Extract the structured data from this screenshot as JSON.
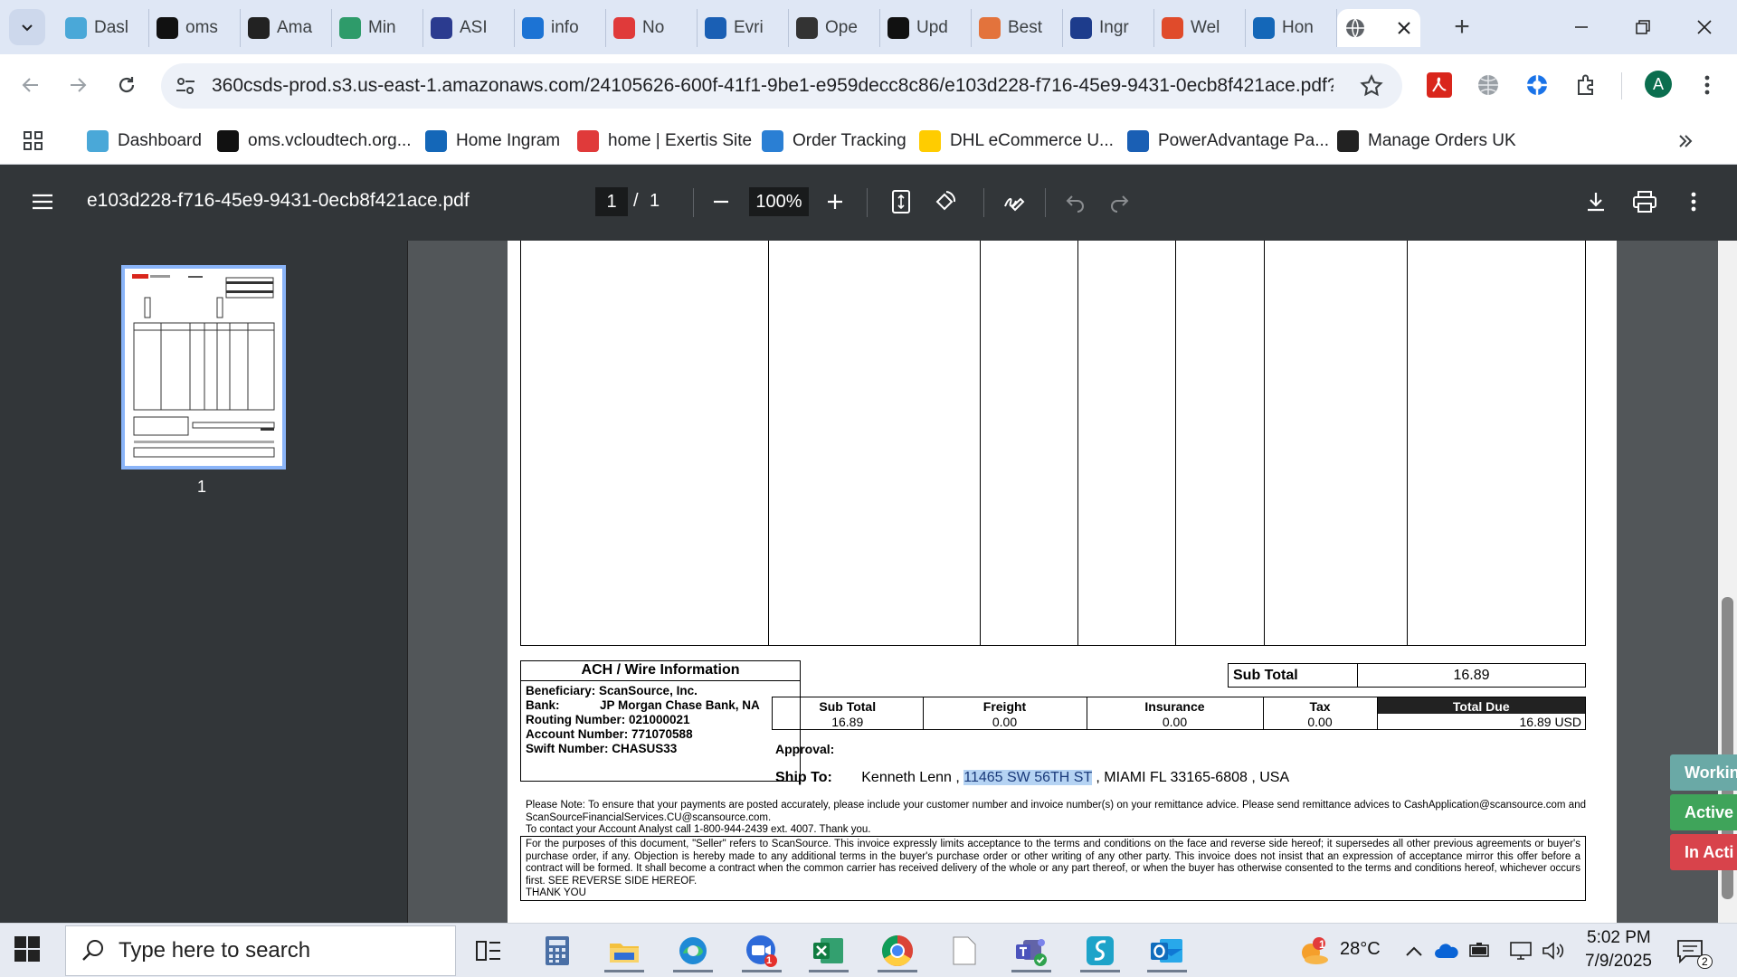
{
  "browser": {
    "tabs": [
      {
        "label": "Dasl",
        "icon": "hexagon-icon",
        "color": "#4aa8d8"
      },
      {
        "label": "oms",
        "icon": "triangle-logo-icon",
        "color": "#111111"
      },
      {
        "label": "Ama",
        "icon": "amazon-icon",
        "color": "#222222"
      },
      {
        "label": "Min",
        "icon": "leaf-icon",
        "color": "#2e9b6a"
      },
      {
        "label": "ASI",
        "icon": "arrow-logo-icon",
        "color": "#2b3b8f"
      },
      {
        "label": "info",
        "icon": "link-logo-icon",
        "color": "#1c73d4"
      },
      {
        "label": "No",
        "icon": "exertis-icon",
        "color": "#e03a3a"
      },
      {
        "label": "Evri",
        "icon": "evri-icon",
        "color": "#1a5fb4"
      },
      {
        "label": "Ope",
        "icon": "openai-icon",
        "color": "#333333"
      },
      {
        "label": "Upd",
        "icon": "openai-icon",
        "color": "#111111"
      },
      {
        "label": "Best",
        "icon": "bulb-icon",
        "color": "#e3733c"
      },
      {
        "label": "Ingr",
        "icon": "ingram-icon",
        "color": "#1d3c8c"
      },
      {
        "label": "Wel",
        "icon": "stack-icon",
        "color": "#e04b2b"
      },
      {
        "label": "Hon",
        "icon": "etn-icon",
        "color": "#1467b8"
      }
    ],
    "active_tab": {
      "icon": "globe-icon"
    },
    "url": "360csds-prod.s3.us-east-1.amazonaws.com/24105626-600f-41f1-9be1-e959decc8c86/e103d228-f716-45e9-9431-0ecb8f421ace.pdf?...",
    "profile_initial": "A",
    "bookmarks": [
      {
        "label": "Dashboard",
        "icon": "hexagon-icon",
        "color": "#4aa8d8"
      },
      {
        "label": "oms.vcloudtech.org...",
        "icon": "triangle-logo-icon",
        "color": "#111111"
      },
      {
        "label": "Home Ingram",
        "icon": "ingram-icon",
        "color": "#1467b8"
      },
      {
        "label": "home | Exertis Site",
        "icon": "exertis-icon",
        "color": "#e03a3a"
      },
      {
        "label": "Order Tracking",
        "icon": "order-tracking-icon",
        "color": "#2a7fd4"
      },
      {
        "label": "DHL eCommerce U...",
        "icon": "dhl-icon",
        "color": "#ffcc00"
      },
      {
        "label": "PowerAdvantage Pa...",
        "icon": "document-icon",
        "color": "#1a5fb4"
      },
      {
        "label": "Manage Orders UK",
        "icon": "amazon-icon",
        "color": "#222222"
      }
    ]
  },
  "pdf": {
    "filename": "e103d228-f716-45e9-9431-0ecb8f421ace.pdf",
    "current_page": "1",
    "page_sep": "/",
    "total_pages": "1",
    "zoom": "100%",
    "thumbnail_label": "1"
  },
  "invoice": {
    "ach": {
      "title": "ACH / Wire Information",
      "beneficiary": "Beneficiary: ScanSource, Inc.",
      "bank_label": "Bank:",
      "bank_value": "JP Morgan Chase Bank, NA",
      "routing": "Routing Number: 021000021",
      "account": "Account Number: 771070588",
      "swift": "Swift Number: CHASUS33"
    },
    "subtotal_label": "Sub Total",
    "subtotal_value": "16.89",
    "totals": {
      "headers": [
        "Sub Total",
        "Freight",
        "Insurance",
        "Tax",
        "Total Due"
      ],
      "values": [
        "16.89",
        "0.00",
        "0.00",
        "0.00",
        "16.89 USD"
      ]
    },
    "approval_label": "Approval:",
    "ship_to_label": "Ship To:",
    "ship_to_name": "Kenneth Lenn ,",
    "ship_to_street": "11465 SW 56TH ST",
    "ship_to_rest": ", MIAMI FL  33165-6808 , USA",
    "note": "Please Note: To ensure that your payments are posted accurately, please include your customer number and invoice number(s) on your remittance advice. Please send remittance advices to CashApplication@scansource.com and ScanSourceFinancialServices.CU@scansource.com.",
    "note_contact": "To contact your Account Analyst call 1-800-944-2439 ext. 4007. Thank you.",
    "terms": "For the purposes of this document, \"Seller\" refers to ScanSource. This invoice expressly limits acceptance to the terms and conditions on the face and reverse side hereof; it supersedes all other previous agreements or buyer's purchase order, if any. Objection is hereby made to any additional terms in the buyer's purchase order or other writing of any other party. This invoice does not insist that an expression of acceptance mirror this offer before a contract will be formed. It shall become a contract when the common carrier has received delivery of the whole or any part thereof, or when the buyer has otherwise consented to the terms and conditions hereof, whichever occurs first.  SEE REVERSE SIDE HEREOF.",
    "terms_thanks": "THANK YOU"
  },
  "side_widgets": [
    {
      "label": "Workin",
      "color": "#6aa9a6"
    },
    {
      "label": "Active",
      "color": "#3fa45a"
    },
    {
      "label": "In Acti",
      "color": "#d8434b"
    }
  ],
  "taskbar": {
    "search_placeholder": "Type here to search",
    "teams_badge": "1",
    "weather_badge": "1",
    "temperature": "28°C",
    "time": "5:02 PM",
    "date": "7/9/2025",
    "notification_count": "2"
  }
}
